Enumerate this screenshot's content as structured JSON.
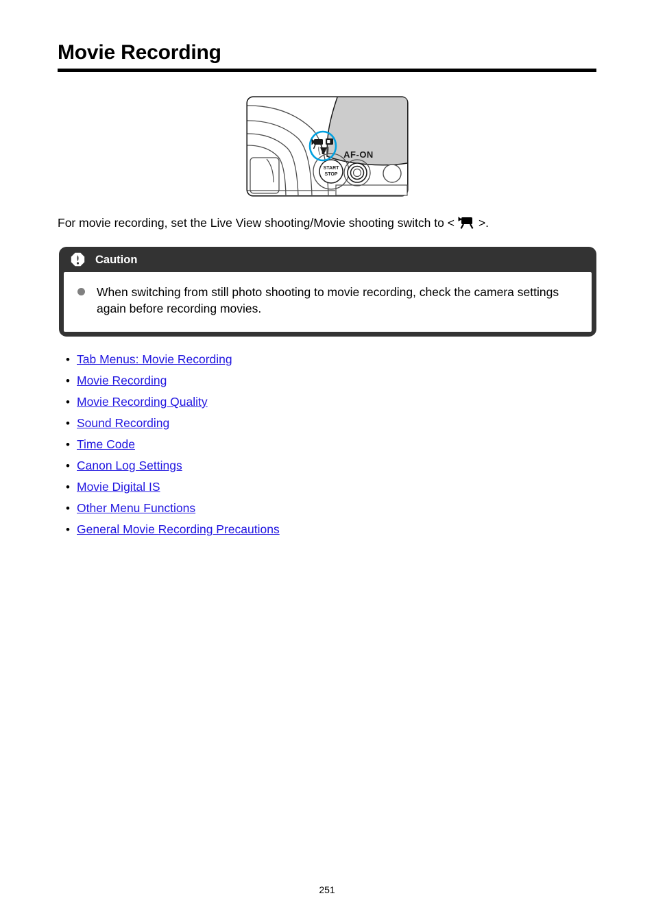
{
  "document": {
    "title": "Movie Recording",
    "page_number": "251"
  },
  "illustration": {
    "name": "camera-rear-controls-diagram",
    "labels": {
      "af_on": "AF-ON",
      "start": "START",
      "stop": "STOP"
    },
    "highlight_color": "#00a0e0",
    "shade_color": "#cccccc",
    "line_color": "#1a1a1a"
  },
  "intro": {
    "text_before": "For movie recording, set the Live View shooting/Movie shooting switch to < ",
    "icon": "movie-camera-icon",
    "text_after": " >."
  },
  "caution": {
    "icon": "exclamation-octagon-icon",
    "title": "Caution",
    "header_bg": "#333333",
    "bullet_color": "#808080",
    "items": [
      "When switching from still photo shooting to movie recording, check the camera settings again before recording movies."
    ]
  },
  "links": {
    "bullet": "•",
    "color": "#2116e0",
    "items": [
      {
        "label": "Tab Menus: Movie Recording"
      },
      {
        "label": "Movie Recording"
      },
      {
        "label": "Movie Recording Quality"
      },
      {
        "label": "Sound Recording"
      },
      {
        "label": "Time Code"
      },
      {
        "label": "Canon Log Settings"
      },
      {
        "label": "Movie Digital IS"
      },
      {
        "label": "Other Menu Functions"
      },
      {
        "label": "General Movie Recording Precautions"
      }
    ]
  }
}
